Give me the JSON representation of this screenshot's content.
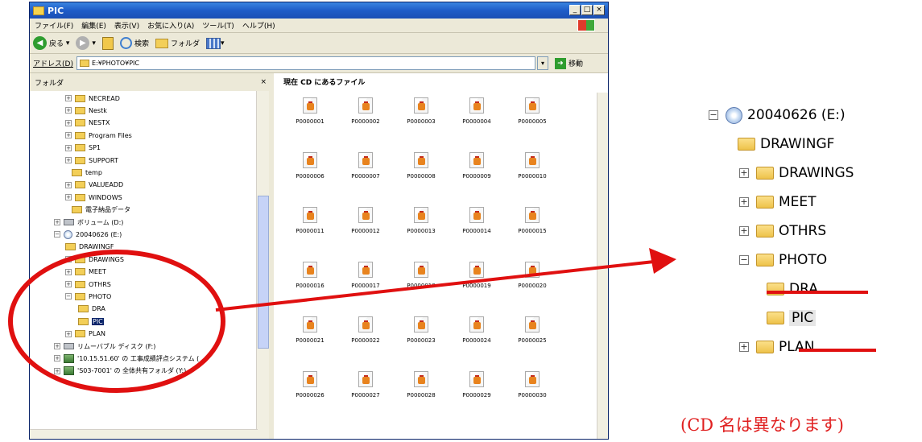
{
  "window": {
    "title": "PIC",
    "controls": [
      "_",
      "□",
      "×"
    ],
    "menu": [
      "ファイル(F)",
      "編集(E)",
      "表示(V)",
      "お気に入り(A)",
      "ツール(T)",
      "ヘルプ(H)"
    ],
    "toolbar": {
      "back": "戻る",
      "search": "検索",
      "folders": "フォルダ"
    },
    "address": {
      "label": "アドレス(D)",
      "value": "E:¥PHOTO¥PIC",
      "go": "移動"
    }
  },
  "folder_pane": {
    "header": "フォルダ",
    "close": "×",
    "nodes": [
      {
        "label": "NECREAD",
        "exp": "+"
      },
      {
        "label": "Nestk",
        "exp": "+"
      },
      {
        "label": "NESTX",
        "exp": "+"
      },
      {
        "label": "Program Files",
        "exp": "+"
      },
      {
        "label": "SP1",
        "exp": "+"
      },
      {
        "label": "SUPPORT",
        "exp": "+"
      },
      {
        "label": "temp",
        "exp": ""
      },
      {
        "label": "VALUEADD",
        "exp": "+"
      },
      {
        "label": "WINDOWS",
        "exp": "+"
      },
      {
        "label": "電子納品データ",
        "exp": ""
      },
      {
        "label": "ボリューム (D:)",
        "exp": "+"
      },
      {
        "label": "20040626 (E:)",
        "exp": "−"
      },
      {
        "label": "DRAWINGF",
        "exp": ""
      },
      {
        "label": "DRAWINGS",
        "exp": "+"
      },
      {
        "label": "MEET",
        "exp": "+"
      },
      {
        "label": "OTHRS",
        "exp": "+"
      },
      {
        "label": "PHOTO",
        "exp": "−"
      },
      {
        "label": "DRA",
        "exp": ""
      },
      {
        "label": "PIC",
        "exp": ""
      },
      {
        "label": "PLAN",
        "exp": "+"
      },
      {
        "label": "リムーバブル ディスク (F:)",
        "exp": "+"
      },
      {
        "label": "'10.15.51.60' の 工事成績評点システム (",
        "exp": "+"
      },
      {
        "label": "'S03-7001' の 全体共有フォルダ (Y:)",
        "exp": "+"
      }
    ]
  },
  "file_pane": {
    "header": "現在 CD にあるファイル",
    "files": [
      "P0000001",
      "P0000002",
      "P0000003",
      "P0000004",
      "P0000005",
      "P0000006",
      "P0000007",
      "P0000008",
      "P0000009",
      "P0000010",
      "P0000011",
      "P0000012",
      "P0000013",
      "P0000014",
      "P0000015",
      "P0000016",
      "P0000017",
      "P0000018",
      "P0000019",
      "P0000020",
      "P0000021",
      "P0000022",
      "P0000023",
      "P0000024",
      "P0000025",
      "P0000026",
      "P0000027",
      "P0000028",
      "P0000029",
      "P0000030"
    ]
  },
  "zoom_tree": {
    "nodes": [
      {
        "label": "20040626 (E:)",
        "exp": "−"
      },
      {
        "label": "DRAWINGF",
        "exp": ""
      },
      {
        "label": "DRAWINGS",
        "exp": "+"
      },
      {
        "label": "MEET",
        "exp": "+"
      },
      {
        "label": "OTHRS",
        "exp": "+"
      },
      {
        "label": "PHOTO",
        "exp": "−"
      },
      {
        "label": "DRA",
        "exp": ""
      },
      {
        "label": "PIC",
        "exp": ""
      },
      {
        "label": "PLAN",
        "exp": "+"
      }
    ]
  },
  "note": "(CD 名は異なります)",
  "colors": {
    "annotation": "#e01010",
    "title_bar": "#1f5cc8",
    "selection": "#0a246a"
  }
}
